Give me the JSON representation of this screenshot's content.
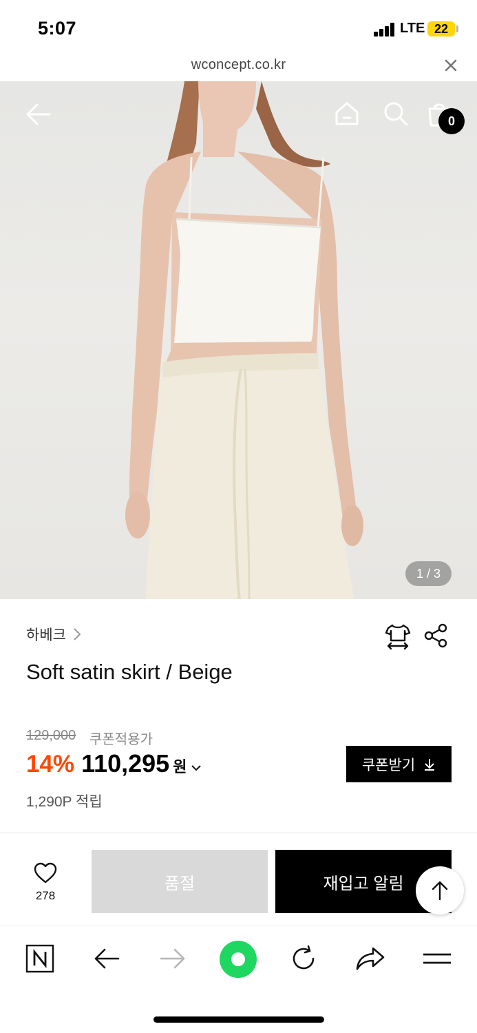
{
  "status_bar": {
    "time": "5:07",
    "network": "LTE",
    "battery": "22"
  },
  "url_bar": {
    "url": "wconcept.co.kr"
  },
  "hero": {
    "cart_count": "0",
    "page_indicator": "1 / 3"
  },
  "product": {
    "brand": "하베크",
    "title": "Soft satin skirt / Beige",
    "original_price": "129,000",
    "coupon_label": "쿠폰적용가",
    "discount": "14%",
    "price": "110,295",
    "currency": "원",
    "points": "1,290P 적립",
    "coupon_button": "쿠폰받기"
  },
  "actions": {
    "wish_count": "278",
    "soldout_label": "품절",
    "restock_label": "재입고 알림"
  },
  "icons": [
    "back-arrow-icon",
    "home-icon",
    "search-icon",
    "shopping-bag-icon",
    "size-guide-icon",
    "share-icon",
    "chevron-right-icon",
    "chevron-down-icon",
    "download-icon",
    "heart-icon",
    "arrow-up-icon",
    "naver-n-icon",
    "arrow-left-icon",
    "arrow-right-icon",
    "green-dot-icon",
    "refresh-icon",
    "forward-share-icon",
    "menu-icon"
  ],
  "colors": {
    "discount": "#ff4800",
    "soldout_bg": "#d9d9d9",
    "primary_black": "#000000",
    "green_accent": "#1ed760"
  }
}
